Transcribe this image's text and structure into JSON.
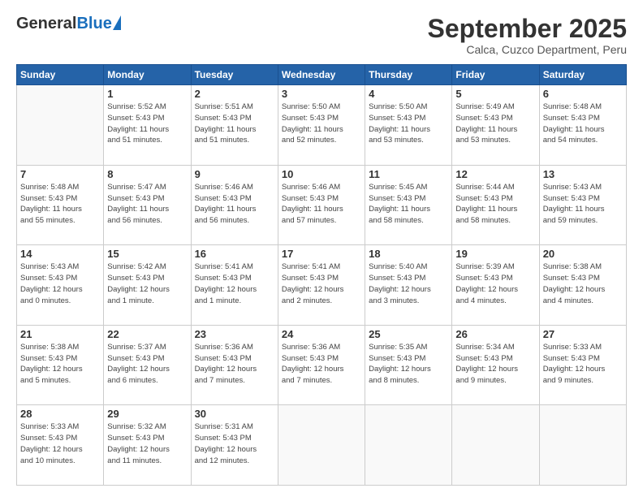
{
  "header": {
    "logo_general": "General",
    "logo_blue": "Blue",
    "month_title": "September 2025",
    "subtitle": "Calca, Cuzco Department, Peru"
  },
  "days_of_week": [
    "Sunday",
    "Monday",
    "Tuesday",
    "Wednesday",
    "Thursday",
    "Friday",
    "Saturday"
  ],
  "weeks": [
    [
      {
        "day": "",
        "info": ""
      },
      {
        "day": "1",
        "info": "Sunrise: 5:52 AM\nSunset: 5:43 PM\nDaylight: 11 hours\nand 51 minutes."
      },
      {
        "day": "2",
        "info": "Sunrise: 5:51 AM\nSunset: 5:43 PM\nDaylight: 11 hours\nand 51 minutes."
      },
      {
        "day": "3",
        "info": "Sunrise: 5:50 AM\nSunset: 5:43 PM\nDaylight: 11 hours\nand 52 minutes."
      },
      {
        "day": "4",
        "info": "Sunrise: 5:50 AM\nSunset: 5:43 PM\nDaylight: 11 hours\nand 53 minutes."
      },
      {
        "day": "5",
        "info": "Sunrise: 5:49 AM\nSunset: 5:43 PM\nDaylight: 11 hours\nand 53 minutes."
      },
      {
        "day": "6",
        "info": "Sunrise: 5:48 AM\nSunset: 5:43 PM\nDaylight: 11 hours\nand 54 minutes."
      }
    ],
    [
      {
        "day": "7",
        "info": "Sunrise: 5:48 AM\nSunset: 5:43 PM\nDaylight: 11 hours\nand 55 minutes."
      },
      {
        "day": "8",
        "info": "Sunrise: 5:47 AM\nSunset: 5:43 PM\nDaylight: 11 hours\nand 56 minutes."
      },
      {
        "day": "9",
        "info": "Sunrise: 5:46 AM\nSunset: 5:43 PM\nDaylight: 11 hours\nand 56 minutes."
      },
      {
        "day": "10",
        "info": "Sunrise: 5:46 AM\nSunset: 5:43 PM\nDaylight: 11 hours\nand 57 minutes."
      },
      {
        "day": "11",
        "info": "Sunrise: 5:45 AM\nSunset: 5:43 PM\nDaylight: 11 hours\nand 58 minutes."
      },
      {
        "day": "12",
        "info": "Sunrise: 5:44 AM\nSunset: 5:43 PM\nDaylight: 11 hours\nand 58 minutes."
      },
      {
        "day": "13",
        "info": "Sunrise: 5:43 AM\nSunset: 5:43 PM\nDaylight: 11 hours\nand 59 minutes."
      }
    ],
    [
      {
        "day": "14",
        "info": "Sunrise: 5:43 AM\nSunset: 5:43 PM\nDaylight: 12 hours\nand 0 minutes."
      },
      {
        "day": "15",
        "info": "Sunrise: 5:42 AM\nSunset: 5:43 PM\nDaylight: 12 hours\nand 1 minute."
      },
      {
        "day": "16",
        "info": "Sunrise: 5:41 AM\nSunset: 5:43 PM\nDaylight: 12 hours\nand 1 minute."
      },
      {
        "day": "17",
        "info": "Sunrise: 5:41 AM\nSunset: 5:43 PM\nDaylight: 12 hours\nand 2 minutes."
      },
      {
        "day": "18",
        "info": "Sunrise: 5:40 AM\nSunset: 5:43 PM\nDaylight: 12 hours\nand 3 minutes."
      },
      {
        "day": "19",
        "info": "Sunrise: 5:39 AM\nSunset: 5:43 PM\nDaylight: 12 hours\nand 4 minutes."
      },
      {
        "day": "20",
        "info": "Sunrise: 5:38 AM\nSunset: 5:43 PM\nDaylight: 12 hours\nand 4 minutes."
      }
    ],
    [
      {
        "day": "21",
        "info": "Sunrise: 5:38 AM\nSunset: 5:43 PM\nDaylight: 12 hours\nand 5 minutes."
      },
      {
        "day": "22",
        "info": "Sunrise: 5:37 AM\nSunset: 5:43 PM\nDaylight: 12 hours\nand 6 minutes."
      },
      {
        "day": "23",
        "info": "Sunrise: 5:36 AM\nSunset: 5:43 PM\nDaylight: 12 hours\nand 7 minutes."
      },
      {
        "day": "24",
        "info": "Sunrise: 5:36 AM\nSunset: 5:43 PM\nDaylight: 12 hours\nand 7 minutes."
      },
      {
        "day": "25",
        "info": "Sunrise: 5:35 AM\nSunset: 5:43 PM\nDaylight: 12 hours\nand 8 minutes."
      },
      {
        "day": "26",
        "info": "Sunrise: 5:34 AM\nSunset: 5:43 PM\nDaylight: 12 hours\nand 9 minutes."
      },
      {
        "day": "27",
        "info": "Sunrise: 5:33 AM\nSunset: 5:43 PM\nDaylight: 12 hours\nand 9 minutes."
      }
    ],
    [
      {
        "day": "28",
        "info": "Sunrise: 5:33 AM\nSunset: 5:43 PM\nDaylight: 12 hours\nand 10 minutes."
      },
      {
        "day": "29",
        "info": "Sunrise: 5:32 AM\nSunset: 5:43 PM\nDaylight: 12 hours\nand 11 minutes."
      },
      {
        "day": "30",
        "info": "Sunrise: 5:31 AM\nSunset: 5:43 PM\nDaylight: 12 hours\nand 12 minutes."
      },
      {
        "day": "",
        "info": ""
      },
      {
        "day": "",
        "info": ""
      },
      {
        "day": "",
        "info": ""
      },
      {
        "day": "",
        "info": ""
      }
    ]
  ]
}
